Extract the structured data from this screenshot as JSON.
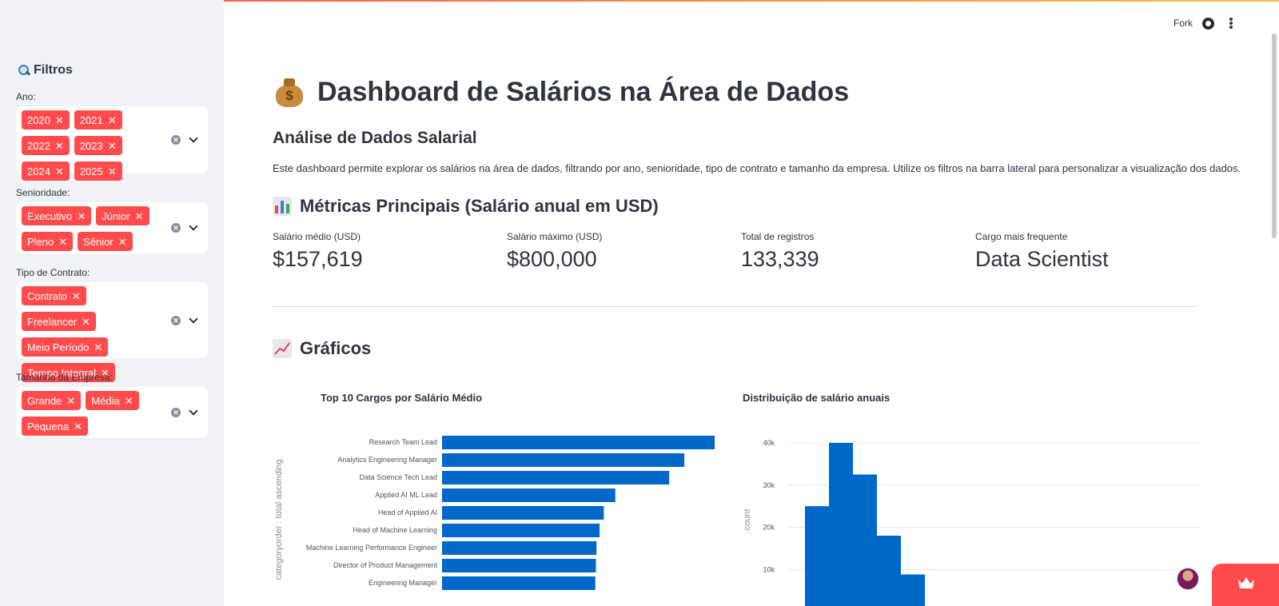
{
  "header": {
    "fork_label": "Fork"
  },
  "sidebar": {
    "title": "Filtros",
    "filters": [
      {
        "label": "Ano:",
        "chips": [
          "2020",
          "2021",
          "2022",
          "2023",
          "2024",
          "2025"
        ]
      },
      {
        "label": "Senioridade:",
        "chips": [
          "Executivo",
          "Júnior",
          "Pleno",
          "Sênior"
        ]
      },
      {
        "label": "Tipo de Contrato:",
        "chips": [
          "Contrato",
          "Freelancer",
          "Meio Período",
          "Tempo Integral"
        ]
      },
      {
        "label": "Tamanho da Empresa:",
        "chips": [
          "Grande",
          "Média",
          "Pequena"
        ]
      }
    ]
  },
  "main": {
    "title": "Dashboard de Salários na Área de Dados",
    "subtitle": "Análise de Dados Salarial",
    "description": "Este dashboard permite explorar os salários na área de dados, filtrando por ano, senioridade, tipo de contrato e tamanho da empresa. Utilize os filtros na barra lateral para personalizar a visualização dos dados.",
    "metrics_heading": "Métricas Principais (Salário anual em USD)",
    "metrics": [
      {
        "label": "Salário médio (USD)",
        "value": "$157,619"
      },
      {
        "label": "Salário máximo (USD)",
        "value": "$800,000"
      },
      {
        "label": "Total de registros",
        "value": "133,339"
      },
      {
        "label": "Cargo mais frequente",
        "value": "Data Scientist"
      }
    ],
    "charts_heading": "Gráficos"
  },
  "chart_data": [
    {
      "type": "bar",
      "orientation": "horizontal",
      "title": "Top 10 Cargos por Salário Médio",
      "ylabel": "categoryorder : total ascending",
      "categories": [
        "Research Team Lead",
        "Analytics Engineering Manager",
        "Data Science Tech Lead",
        "Applied AI ML Lead",
        "Head of Applied AI",
        "Head of Machine Learning",
        "Machine Learning Performance Engineer",
        "Director of Product Management",
        "Engineering Manager"
      ],
      "values": [
        450000,
        400000,
        375000,
        286000,
        267000,
        260000,
        255000,
        254000,
        253000
      ],
      "xlim": [
        0,
        450000
      ],
      "color": "#0068c9"
    },
    {
      "type": "bar",
      "title": "Distribuição de salário anuais",
      "ylabel": "count",
      "ytick_labels": [
        "10k",
        "20k",
        "30k",
        "40k"
      ],
      "ylim": [
        0,
        40000
      ],
      "values": [
        25000,
        40000,
        32500,
        18000,
        8800
      ],
      "color": "#0068c9"
    }
  ],
  "colors": {
    "accent": "#ff4b4b",
    "bar": "#0068c9",
    "sidebar_bg": "#f0f2f6"
  }
}
